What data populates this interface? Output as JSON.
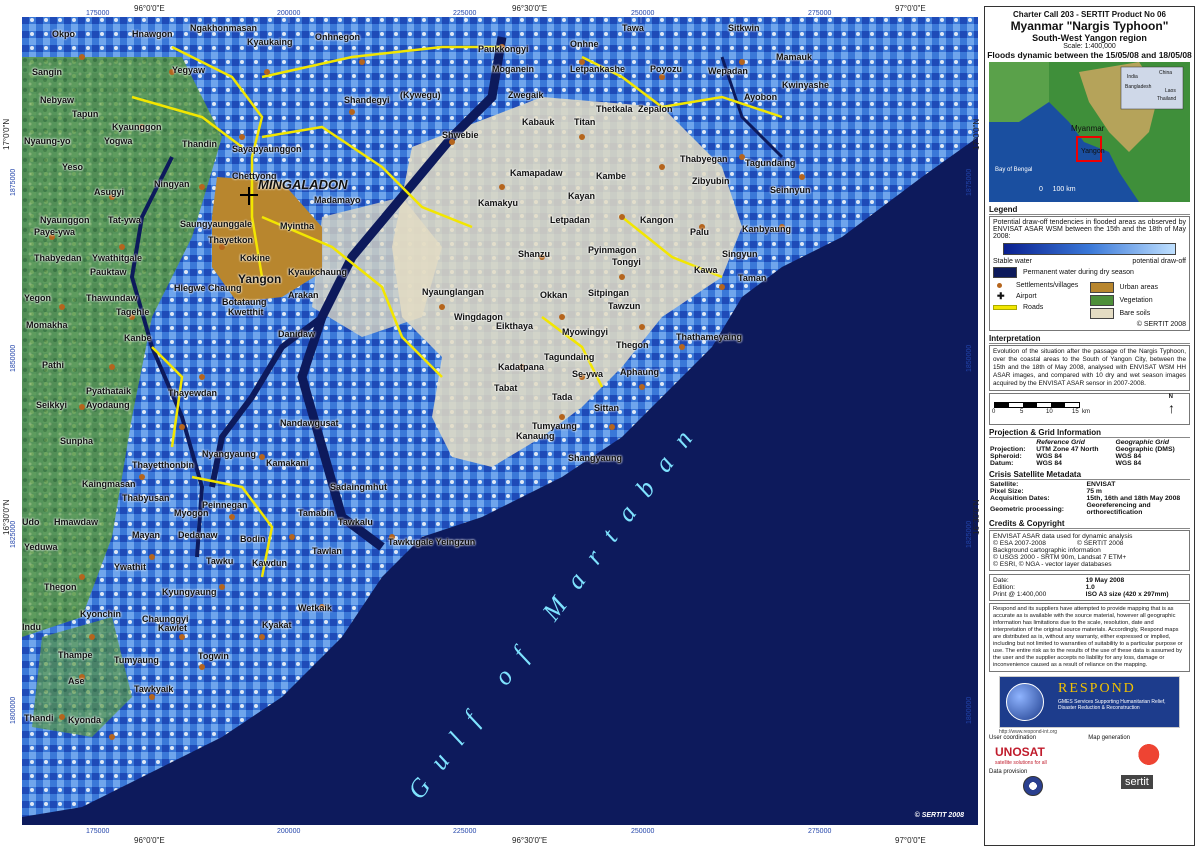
{
  "map": {
    "top_ticks": [
      "175000",
      "200000",
      "225000",
      "250000",
      "275000"
    ],
    "top_degrees": [
      "96°0'0\"E",
      "96°30'0\"E",
      "97°0'0\"E"
    ],
    "left_ticks": [
      "1875000",
      "1850000",
      "1825000",
      "1800000"
    ],
    "left_degrees": [
      "17°0'0\"N",
      "16°30'0\"N"
    ],
    "gulf_label": "Gulf of Martaban",
    "copyright": "© SERTIT 2008",
    "places": [
      {
        "name": "Okpo"
      },
      {
        "name": "Hnawgon"
      },
      {
        "name": "Ngakhonmasan"
      },
      {
        "name": "Kyaukaing"
      },
      {
        "name": "Onhnegon"
      },
      {
        "name": "Paukkongyi"
      },
      {
        "name": "Onhne"
      },
      {
        "name": "Tawa"
      },
      {
        "name": "Sitkwin"
      },
      {
        "name": "Sangin"
      },
      {
        "name": "Yegyaw"
      },
      {
        "name": "Moganein"
      },
      {
        "name": "Letpankashe"
      },
      {
        "name": "Poyozu"
      },
      {
        "name": "Wepadan"
      },
      {
        "name": "Mamauk"
      },
      {
        "name": "Nebyaw"
      },
      {
        "name": "Shandegyi"
      },
      {
        "name": "(Kywegu)"
      },
      {
        "name": "Zwegaik"
      },
      {
        "name": "Kwinyashe"
      },
      {
        "name": "Ayobon"
      },
      {
        "name": "Tapun"
      },
      {
        "name": "Thetkala"
      },
      {
        "name": "Zepalon"
      },
      {
        "name": "Kyaunggon"
      },
      {
        "name": "Kabauk"
      },
      {
        "name": "Titan"
      },
      {
        "name": "Nyaung-yo"
      },
      {
        "name": "Yogwa"
      },
      {
        "name": "Shwebie"
      },
      {
        "name": "Thandin"
      },
      {
        "name": "Sayapyaunggon"
      },
      {
        "name": "Thabyegan"
      },
      {
        "name": "Tagundaing"
      },
      {
        "name": "Yeso"
      },
      {
        "name": "Ningyan"
      },
      {
        "name": "Chettyong"
      },
      {
        "name": "MINGALADON"
      },
      {
        "name": "Kamapadaw"
      },
      {
        "name": "Kambe"
      },
      {
        "name": "Zibyubin"
      },
      {
        "name": "Seinnyun"
      },
      {
        "name": "Asugyi"
      },
      {
        "name": "Madamayo"
      },
      {
        "name": "Kamakyu"
      },
      {
        "name": "Kayan"
      },
      {
        "name": "Nyaunggon"
      },
      {
        "name": "Tat-ywa"
      },
      {
        "name": "Saungyaunggale"
      },
      {
        "name": "Myintha"
      },
      {
        "name": "Letpadan"
      },
      {
        "name": "Kangon"
      },
      {
        "name": "Kanbyaung"
      },
      {
        "name": "Paye-ywa"
      },
      {
        "name": "Thayetkon"
      },
      {
        "name": "Palu"
      },
      {
        "name": "Pyinmagon"
      },
      {
        "name": "Tongyi"
      },
      {
        "name": "Singyun"
      },
      {
        "name": "Thabyedan"
      },
      {
        "name": "Ywathitgale"
      },
      {
        "name": "Kokine"
      },
      {
        "name": "Shanzu"
      },
      {
        "name": "Kawa"
      },
      {
        "name": "Taman"
      },
      {
        "name": "Pauktaw"
      },
      {
        "name": "Yangon"
      },
      {
        "name": "Kyaukchaung"
      },
      {
        "name": "Hlegwe Chaung"
      },
      {
        "name": "Nyaunglangan"
      },
      {
        "name": "Okkan"
      },
      {
        "name": "Sitpingan"
      },
      {
        "name": "Yegon"
      },
      {
        "name": "Thawundaw"
      },
      {
        "name": "Arakan"
      },
      {
        "name": "Botataung"
      },
      {
        "name": "Tawzun"
      },
      {
        "name": "Tagehle"
      },
      {
        "name": "Kwetthit"
      },
      {
        "name": "Wingdagon"
      },
      {
        "name": "Momakha"
      },
      {
        "name": "Danidaw"
      },
      {
        "name": "Eikthaya"
      },
      {
        "name": "Myowingyi"
      },
      {
        "name": "Kanbe"
      },
      {
        "name": "Thathameyaing"
      },
      {
        "name": "Thegon"
      },
      {
        "name": "Tagundaing"
      },
      {
        "name": "Pathi"
      },
      {
        "name": "Kadatpana"
      },
      {
        "name": "Se-ywa"
      },
      {
        "name": "Aphaung"
      },
      {
        "name": "Pyathataik"
      },
      {
        "name": "Tabat"
      },
      {
        "name": "Thayewdan"
      },
      {
        "name": "Seikkyi"
      },
      {
        "name": "Ayodaung"
      },
      {
        "name": "Tada"
      },
      {
        "name": "Sittan"
      },
      {
        "name": "Nandawgusat"
      },
      {
        "name": "Tumyaung"
      },
      {
        "name": "Kanaung"
      },
      {
        "name": "Sunpha"
      },
      {
        "name": "Nyangyaung"
      },
      {
        "name": "Shangyaung"
      },
      {
        "name": "Kamakani"
      },
      {
        "name": "Thayetthonbin"
      },
      {
        "name": "Kaingmasan"
      },
      {
        "name": "Sadaingmhut"
      },
      {
        "name": "Thabyusan"
      },
      {
        "name": "Peinnegan"
      },
      {
        "name": "Tamabin"
      },
      {
        "name": "Myogon"
      },
      {
        "name": "Tawkalu"
      },
      {
        "name": "Hmawdaw"
      },
      {
        "name": "Udo"
      },
      {
        "name": "Dedanaw"
      },
      {
        "name": "Mayan"
      },
      {
        "name": "Bodin"
      },
      {
        "name": "Tawkugale Yeingzun"
      },
      {
        "name": "Yeduwa"
      },
      {
        "name": "Tawlan"
      },
      {
        "name": "Ywathit"
      },
      {
        "name": "Tawku"
      },
      {
        "name": "Kawdun"
      },
      {
        "name": "Thegon"
      },
      {
        "name": "Kyungyaung"
      },
      {
        "name": "Wetkaik"
      },
      {
        "name": "Kyonchin"
      },
      {
        "name": "Chaunggyi"
      },
      {
        "name": "Kyakat"
      },
      {
        "name": "Kawlet"
      },
      {
        "name": "Indu"
      },
      {
        "name": "Thampe"
      },
      {
        "name": "Tumyaung"
      },
      {
        "name": "Togwin"
      },
      {
        "name": "Ase"
      },
      {
        "name": "Tawkyaik"
      },
      {
        "name": "Thandi"
      },
      {
        "name": "Kyonda"
      }
    ]
  },
  "panel": {
    "header": {
      "line1": "Charter Call 203 - SERTIT Product No 06",
      "line2": "Myanmar \"Nargis Typhoon\"",
      "line3": "South-West Yangon region",
      "line4": "Scale: 1:400,000",
      "line5": "Floods dynamic between the 15/05/08 and 18/05/08"
    },
    "inset": {
      "country": "Myanmar",
      "city": "Yangon",
      "sea": "Bay of Bengal",
      "scale": "0     100 km",
      "countries": [
        "China",
        "India",
        "Bangladesh",
        "Laos",
        "Thailand"
      ]
    },
    "legend": {
      "title": "Legend",
      "intro": "Potential draw-off tendencies in flooded areas as observed by ENVISAT ASAR WSM between the 15th and the 18th of May 2008:",
      "ramp_left": "Stable water",
      "ramp_right": "potential draw-off",
      "items": [
        {
          "label": "Permanent water during dry season",
          "color": "#0d1a5c"
        },
        {
          "label": "Settlements/villages",
          "color": "#b5651d"
        },
        {
          "label": "Urban areas",
          "color": "#b8862e"
        },
        {
          "label": "Airport",
          "color": "#000000"
        },
        {
          "label": "Vegetation",
          "color": "#4e8f3a"
        },
        {
          "label": "Roads",
          "color": "#f2e600"
        },
        {
          "label": "Bare soils",
          "color": "#e4dcc3"
        }
      ],
      "copyright": "© SERTIT 2008"
    },
    "interpretation": {
      "title": "Interpretation",
      "text": "Evolution of the situation after the passage of the Nargis Typhoon, over the coastal areas to the South of Yangon City, between the 15th and the 18th of May 2008, analysed with ENVISAT WSM HH ASAR images, and compared with 10 dry and wet season images acquired by the ENVISAT ASAR sensor in 2007-2008."
    },
    "scalebar": {
      "labels": [
        "0",
        "5",
        "10",
        "15"
      ],
      "unit": "km",
      "north": "N"
    },
    "projection": {
      "title": "Projection & Grid Information",
      "col1": "Reference Grid",
      "col2": "Geographic Grid",
      "rows": [
        {
          "k": "Projection:",
          "a": "UTM Zone 47 North",
          "b": "Geographic (DMS)"
        },
        {
          "k": "Spheroid:",
          "a": "WGS 84",
          "b": "WGS 84"
        },
        {
          "k": "Datum:",
          "a": "WGS 84",
          "b": "WGS 84"
        }
      ]
    },
    "satellite": {
      "title": "Crisis Satellite Metadata",
      "rows": [
        {
          "k": "Satellite:",
          "v": "ENVISAT"
        },
        {
          "k": "Pixel Size:",
          "v": "75 m"
        },
        {
          "k": "Acquisition Dates:",
          "v": "15th, 16th and 18th May 2008"
        },
        {
          "k": "Geometric processing:",
          "v": "Georeferencing and orthorectification"
        }
      ]
    },
    "credits": {
      "title": "Credits & Copyright",
      "lines": [
        "ENVISAT ASAR data used for dynamic analysis",
        "© ESA 2007-2008                 © SERTIT 2008",
        "Background cartographic information",
        "© USGS 2000 - SRTM 90m, Landsat 7 ETM+",
        "© ESRI, © NGA - vector layer databases"
      ]
    },
    "edition": {
      "rows": [
        {
          "k": "Date:",
          "v": "19 May 2008"
        },
        {
          "k": "Edition:",
          "v": "1.0"
        },
        {
          "k": "Print @ 1:400,000",
          "v": "ISO A3 size (420 x 297mm)"
        }
      ]
    },
    "disclaimer": "Respond and its suppliers have attempted to provide mapping that is as accurate as is available with the source material, however all geographic information has limitations due to the scale, resolution, date and interpretation of the original source materials. Accordingly, Respond maps are distributed as is, without any warranty, either expressed or implied, including but not limited to warranties of suitability to a particular purpose or use. The entire risk as to the results of the use of these data is assumed by the user and the supplier accepts no liability for any loss, damage or inconvenience caused as a result of reliance on the mapping.",
    "respond": {
      "name": "RESPOND",
      "tag": "GMES Services Supporting Humanitarian Relief, Disaster Reduction & Reconstruction",
      "url": "http://www.respond-int.org"
    },
    "partners": {
      "left_label": "User coordination",
      "right_label": "Map generation",
      "unosat": "UNOSAT",
      "unosat_tag": "satellite solutions for all",
      "provision": "Data provision",
      "sertit": "sertit"
    }
  }
}
